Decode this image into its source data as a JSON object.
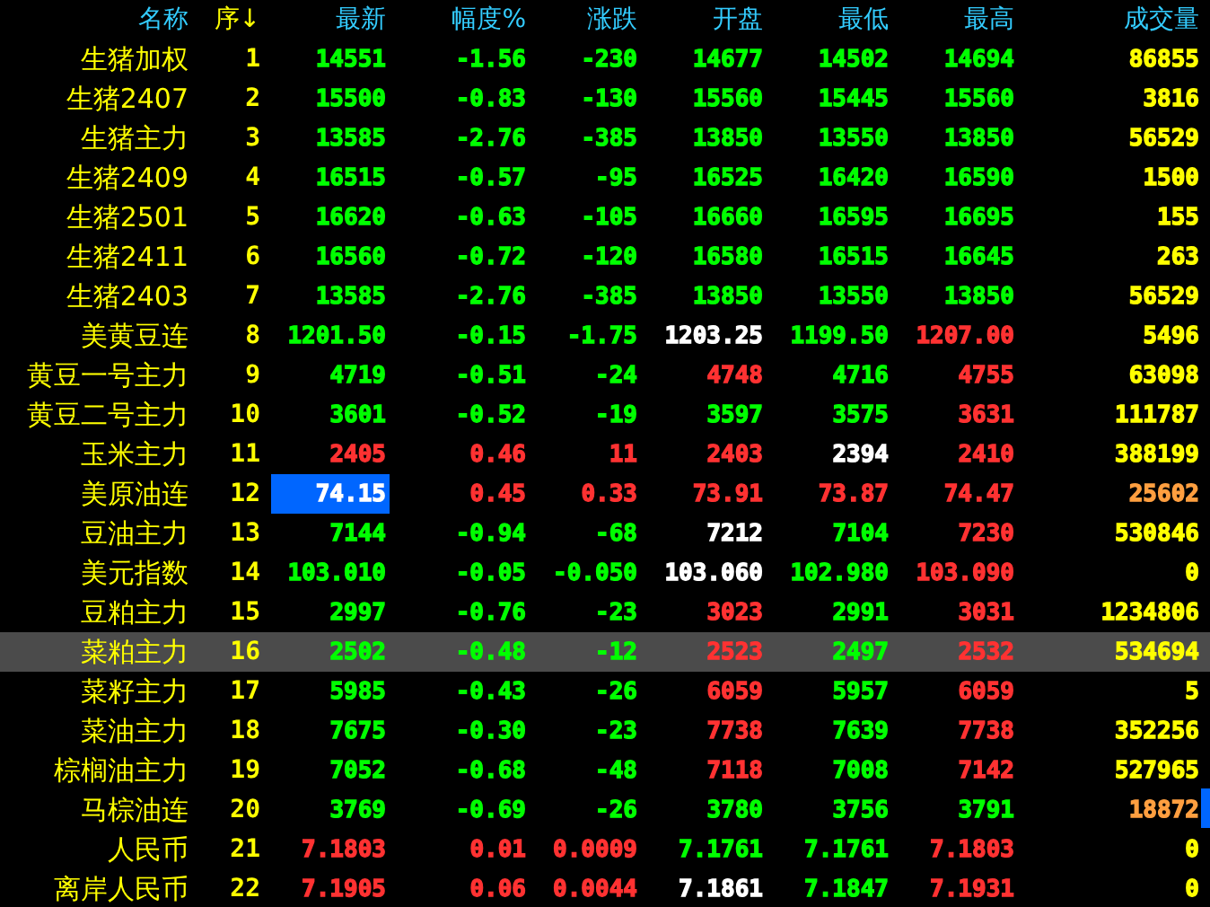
{
  "columns": [
    {
      "label": "名称",
      "sorted": false
    },
    {
      "label": "序",
      "sorted": true,
      "arrow": "↓"
    },
    {
      "label": "最新",
      "sorted": false
    },
    {
      "label": "幅度%",
      "sorted": false
    },
    {
      "label": "涨跌",
      "sorted": false
    },
    {
      "label": "开盘",
      "sorted": false
    },
    {
      "label": "最低",
      "sorted": false
    },
    {
      "label": "最高",
      "sorted": false
    },
    {
      "label": "成交量",
      "sorted": false
    }
  ],
  "rows": [
    {
      "name": "生猪加权",
      "seq": "1",
      "selected": false,
      "cells": [
        {
          "text": "14551",
          "color": "#00ff00"
        },
        {
          "text": "-1.56",
          "color": "#00ff00"
        },
        {
          "text": "-230",
          "color": "#00ff00"
        },
        {
          "text": "14677",
          "color": "#00ff00"
        },
        {
          "text": "14502",
          "color": "#00ff00"
        },
        {
          "text": "14694",
          "color": "#00ff00"
        },
        {
          "text": "86855",
          "color": "#ffff00"
        }
      ]
    },
    {
      "name": "生猪2407",
      "seq": "2",
      "selected": false,
      "cells": [
        {
          "text": "15500",
          "color": "#00ff00"
        },
        {
          "text": "-0.83",
          "color": "#00ff00"
        },
        {
          "text": "-130",
          "color": "#00ff00"
        },
        {
          "text": "15560",
          "color": "#00ff00"
        },
        {
          "text": "15445",
          "color": "#00ff00"
        },
        {
          "text": "15560",
          "color": "#00ff00"
        },
        {
          "text": "3816",
          "color": "#ffff00"
        }
      ]
    },
    {
      "name": "生猪主力",
      "seq": "3",
      "selected": false,
      "cells": [
        {
          "text": "13585",
          "color": "#00ff00"
        },
        {
          "text": "-2.76",
          "color": "#00ff00"
        },
        {
          "text": "-385",
          "color": "#00ff00"
        },
        {
          "text": "13850",
          "color": "#00ff00"
        },
        {
          "text": "13550",
          "color": "#00ff00"
        },
        {
          "text": "13850",
          "color": "#00ff00"
        },
        {
          "text": "56529",
          "color": "#ffff00"
        }
      ]
    },
    {
      "name": "生猪2409",
      "seq": "4",
      "selected": false,
      "cells": [
        {
          "text": "16515",
          "color": "#00ff00"
        },
        {
          "text": "-0.57",
          "color": "#00ff00"
        },
        {
          "text": "-95",
          "color": "#00ff00"
        },
        {
          "text": "16525",
          "color": "#00ff00"
        },
        {
          "text": "16420",
          "color": "#00ff00"
        },
        {
          "text": "16590",
          "color": "#00ff00"
        },
        {
          "text": "1500",
          "color": "#ffff00"
        }
      ]
    },
    {
      "name": "生猪2501",
      "seq": "5",
      "selected": false,
      "cells": [
        {
          "text": "16620",
          "color": "#00ff00"
        },
        {
          "text": "-0.63",
          "color": "#00ff00"
        },
        {
          "text": "-105",
          "color": "#00ff00"
        },
        {
          "text": "16660",
          "color": "#00ff00"
        },
        {
          "text": "16595",
          "color": "#00ff00"
        },
        {
          "text": "16695",
          "color": "#00ff00"
        },
        {
          "text": "155",
          "color": "#ffff00"
        }
      ]
    },
    {
      "name": "生猪2411",
      "seq": "6",
      "selected": false,
      "cells": [
        {
          "text": "16560",
          "color": "#00ff00"
        },
        {
          "text": "-0.72",
          "color": "#00ff00"
        },
        {
          "text": "-120",
          "color": "#00ff00"
        },
        {
          "text": "16580",
          "color": "#00ff00"
        },
        {
          "text": "16515",
          "color": "#00ff00"
        },
        {
          "text": "16645",
          "color": "#00ff00"
        },
        {
          "text": "263",
          "color": "#ffff00"
        }
      ]
    },
    {
      "name": "生猪2403",
      "seq": "7",
      "selected": false,
      "cells": [
        {
          "text": "13585",
          "color": "#00ff00"
        },
        {
          "text": "-2.76",
          "color": "#00ff00"
        },
        {
          "text": "-385",
          "color": "#00ff00"
        },
        {
          "text": "13850",
          "color": "#00ff00"
        },
        {
          "text": "13550",
          "color": "#00ff00"
        },
        {
          "text": "13850",
          "color": "#00ff00"
        },
        {
          "text": "56529",
          "color": "#ffff00"
        }
      ]
    },
    {
      "name": "美黄豆连",
      "seq": "8",
      "selected": false,
      "cells": [
        {
          "text": "1201.50",
          "color": "#00ff00"
        },
        {
          "text": "-0.15",
          "color": "#00ff00"
        },
        {
          "text": "-1.75",
          "color": "#00ff00"
        },
        {
          "text": "1203.25",
          "color": "#ffffff"
        },
        {
          "text": "1199.50",
          "color": "#00ff00"
        },
        {
          "text": "1207.00",
          "color": "#ff3232"
        },
        {
          "text": "5496",
          "color": "#ffff00"
        }
      ]
    },
    {
      "name": "黄豆一号主力",
      "seq": "9",
      "selected": false,
      "cells": [
        {
          "text": "4719",
          "color": "#00ff00"
        },
        {
          "text": "-0.51",
          "color": "#00ff00"
        },
        {
          "text": "-24",
          "color": "#00ff00"
        },
        {
          "text": "4748",
          "color": "#ff3232"
        },
        {
          "text": "4716",
          "color": "#00ff00"
        },
        {
          "text": "4755",
          "color": "#ff3232"
        },
        {
          "text": "63098",
          "color": "#ffff00"
        }
      ]
    },
    {
      "name": "黄豆二号主力",
      "seq": "10",
      "selected": false,
      "cells": [
        {
          "text": "3601",
          "color": "#00ff00"
        },
        {
          "text": "-0.52",
          "color": "#00ff00"
        },
        {
          "text": "-19",
          "color": "#00ff00"
        },
        {
          "text": "3597",
          "color": "#00ff00"
        },
        {
          "text": "3575",
          "color": "#00ff00"
        },
        {
          "text": "3631",
          "color": "#ff3232"
        },
        {
          "text": "111787",
          "color": "#ffff00"
        }
      ]
    },
    {
      "name": "玉米主力",
      "seq": "11",
      "selected": false,
      "cells": [
        {
          "text": "2405",
          "color": "#ff3232"
        },
        {
          "text": "0.46",
          "color": "#ff3232"
        },
        {
          "text": "11",
          "color": "#ff3232"
        },
        {
          "text": "2403",
          "color": "#ff3232"
        },
        {
          "text": "2394",
          "color": "#ffffff"
        },
        {
          "text": "2410",
          "color": "#ff3232"
        },
        {
          "text": "388199",
          "color": "#ffff00"
        }
      ]
    },
    {
      "name": "美原油连",
      "seq": "12",
      "selected": false,
      "cells": [
        {
          "text": "74.15",
          "color": "#ffffff",
          "highlighted": true
        },
        {
          "text": "0.45",
          "color": "#ff3232"
        },
        {
          "text": "0.33",
          "color": "#ff3232"
        },
        {
          "text": "73.91",
          "color": "#ff3232"
        },
        {
          "text": "73.87",
          "color": "#ff3232"
        },
        {
          "text": "74.47",
          "color": "#ff3232"
        },
        {
          "text": "25602",
          "color": "#ff9f40"
        }
      ]
    },
    {
      "name": "豆油主力",
      "seq": "13",
      "selected": false,
      "cells": [
        {
          "text": "7144",
          "color": "#00ff00"
        },
        {
          "text": "-0.94",
          "color": "#00ff00"
        },
        {
          "text": "-68",
          "color": "#00ff00"
        },
        {
          "text": "7212",
          "color": "#ffffff"
        },
        {
          "text": "7104",
          "color": "#00ff00"
        },
        {
          "text": "7230",
          "color": "#ff3232"
        },
        {
          "text": "530846",
          "color": "#ffff00"
        }
      ]
    },
    {
      "name": "美元指数",
      "seq": "14",
      "selected": false,
      "cells": [
        {
          "text": "103.010",
          "color": "#00ff00"
        },
        {
          "text": "-0.05",
          "color": "#00ff00"
        },
        {
          "text": "-0.050",
          "color": "#00ff00"
        },
        {
          "text": "103.060",
          "color": "#ffffff"
        },
        {
          "text": "102.980",
          "color": "#00ff00"
        },
        {
          "text": "103.090",
          "color": "#ff3232"
        },
        {
          "text": "0",
          "color": "#ffff00"
        }
      ]
    },
    {
      "name": "豆粕主力",
      "seq": "15",
      "selected": false,
      "cells": [
        {
          "text": "2997",
          "color": "#00ff00"
        },
        {
          "text": "-0.76",
          "color": "#00ff00"
        },
        {
          "text": "-23",
          "color": "#00ff00"
        },
        {
          "text": "3023",
          "color": "#ff3232"
        },
        {
          "text": "2991",
          "color": "#00ff00"
        },
        {
          "text": "3031",
          "color": "#ff3232"
        },
        {
          "text": "1234806",
          "color": "#ffff00"
        }
      ]
    },
    {
      "name": "菜粕主力",
      "seq": "16",
      "selected": true,
      "cells": [
        {
          "text": "2502",
          "color": "#00ff00"
        },
        {
          "text": "-0.48",
          "color": "#00ff00"
        },
        {
          "text": "-12",
          "color": "#00ff00"
        },
        {
          "text": "2523",
          "color": "#ff3232"
        },
        {
          "text": "2497",
          "color": "#00ff00"
        },
        {
          "text": "2532",
          "color": "#ff3232"
        },
        {
          "text": "534694",
          "color": "#ffff00"
        }
      ]
    },
    {
      "name": "菜籽主力",
      "seq": "17",
      "selected": false,
      "cells": [
        {
          "text": "5985",
          "color": "#00ff00"
        },
        {
          "text": "-0.43",
          "color": "#00ff00"
        },
        {
          "text": "-26",
          "color": "#00ff00"
        },
        {
          "text": "6059",
          "color": "#ff3232"
        },
        {
          "text": "5957",
          "color": "#00ff00"
        },
        {
          "text": "6059",
          "color": "#ff3232"
        },
        {
          "text": "5",
          "color": "#ffff00"
        }
      ]
    },
    {
      "name": "菜油主力",
      "seq": "18",
      "selected": false,
      "cells": [
        {
          "text": "7675",
          "color": "#00ff00"
        },
        {
          "text": "-0.30",
          "color": "#00ff00"
        },
        {
          "text": "-23",
          "color": "#00ff00"
        },
        {
          "text": "7738",
          "color": "#ff3232"
        },
        {
          "text": "7639",
          "color": "#00ff00"
        },
        {
          "text": "7738",
          "color": "#ff3232"
        },
        {
          "text": "352256",
          "color": "#ffff00"
        }
      ]
    },
    {
      "name": "棕榈油主力",
      "seq": "19",
      "selected": false,
      "cells": [
        {
          "text": "7052",
          "color": "#00ff00"
        },
        {
          "text": "-0.68",
          "color": "#00ff00"
        },
        {
          "text": "-48",
          "color": "#00ff00"
        },
        {
          "text": "7118",
          "color": "#ff3232"
        },
        {
          "text": "7008",
          "color": "#00ff00"
        },
        {
          "text": "7142",
          "color": "#ff3232"
        },
        {
          "text": "527965",
          "color": "#ffff00"
        }
      ]
    },
    {
      "name": "马棕油连",
      "seq": "20",
      "selected": false,
      "cells": [
        {
          "text": "3769",
          "color": "#00ff00"
        },
        {
          "text": "-0.69",
          "color": "#00ff00"
        },
        {
          "text": "-26",
          "color": "#00ff00"
        },
        {
          "text": "3780",
          "color": "#00ff00"
        },
        {
          "text": "3756",
          "color": "#00ff00"
        },
        {
          "text": "3791",
          "color": "#00ff00"
        },
        {
          "text": "18872",
          "color": "#ff9f40"
        }
      ]
    },
    {
      "name": "人民币",
      "seq": "21",
      "selected": false,
      "cells": [
        {
          "text": "7.1803",
          "color": "#ff3232"
        },
        {
          "text": "0.01",
          "color": "#ff3232"
        },
        {
          "text": "0.0009",
          "color": "#ff3232"
        },
        {
          "text": "7.1761",
          "color": "#00ff00"
        },
        {
          "text": "7.1761",
          "color": "#00ff00"
        },
        {
          "text": "7.1803",
          "color": "#ff3232"
        },
        {
          "text": "0",
          "color": "#ffff00"
        }
      ]
    },
    {
      "name": "离岸人民币",
      "seq": "22",
      "selected": false,
      "cells": [
        {
          "text": "7.1905",
          "color": "#ff3232"
        },
        {
          "text": "0.06",
          "color": "#ff3232"
        },
        {
          "text": "0.0044",
          "color": "#ff3232"
        },
        {
          "text": "7.1861",
          "color": "#ffffff"
        },
        {
          "text": "7.1847",
          "color": "#00ff00"
        },
        {
          "text": "7.1931",
          "color": "#ff3232"
        },
        {
          "text": "0",
          "color": "#ffff00"
        }
      ]
    }
  ]
}
